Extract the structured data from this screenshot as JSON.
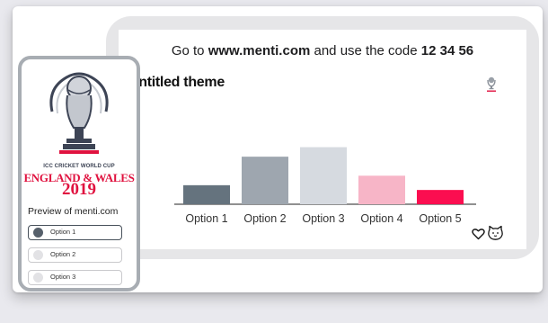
{
  "instruction": {
    "prefix": "Go to ",
    "site": "www.menti.com",
    "middle": " and use the code ",
    "code": "12 34 56"
  },
  "theme_title": "Untitled theme",
  "chart_data": {
    "type": "bar",
    "categories": [
      "Option 1",
      "Option 2",
      "Option 3",
      "Option 4",
      "Option 5"
    ],
    "values": [
      4,
      10,
      12,
      6,
      3
    ],
    "colors": [
      "#65737e",
      "#9ea6af",
      "#d6dae0",
      "#f7b5c7",
      "#fb0e50"
    ],
    "ylim": [
      0,
      14
    ]
  },
  "phone": {
    "logo_line1": "ICC CRICKET WORLD CUP",
    "logo_line2": "ENGLAND & WALES",
    "logo_year": "2019",
    "preview_label": "Preview of menti.com",
    "options": [
      {
        "label": "Option 1",
        "selected": true
      },
      {
        "label": "Option 2",
        "selected": false
      },
      {
        "label": "Option 3",
        "selected": false
      }
    ]
  },
  "icons": {
    "heart": "heart-icon",
    "cat": "cat-icon"
  }
}
